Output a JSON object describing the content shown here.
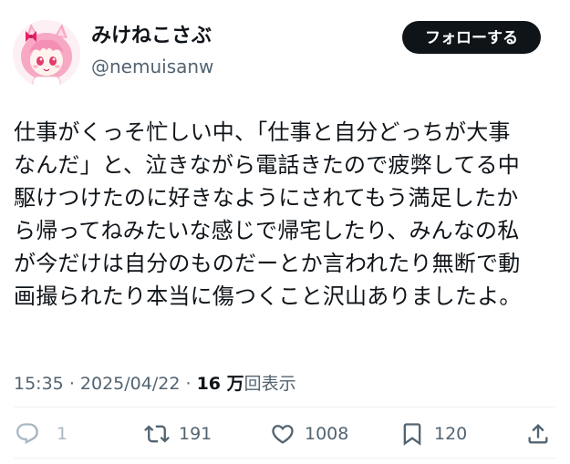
{
  "author": {
    "display_name": "みけねこさぶ",
    "handle": "@nemuisanw"
  },
  "follow_button_label": "フォローする",
  "tweet": {
    "lines": [
      "仕事がくっそ忙しい中、「仕事と自分どっちが大事",
      "なんだ」と、泣きながら電話きたので疲弊してる中",
      "駆けつけたのに好きなようにされてもう満足したか",
      "ら帰ってねみたいな感じで帰宅したり、みんなの私",
      "が今だけは自分のものだーとか言われたり無断で動",
      "画撮られたり本当に傷つくこと沢山ありましたよ。"
    ]
  },
  "meta": {
    "time": "15:35",
    "separator": "·",
    "date": "2025/04/22",
    "views_count": "16 万",
    "views_label": "回表示"
  },
  "actions": {
    "reply_count": "1",
    "retweet_count": "191",
    "like_count": "1008",
    "bookmark_count": "120"
  },
  "icons": {
    "reply": "reply-icon",
    "retweet": "retweet-icon",
    "like": "heart-icon",
    "bookmark": "bookmark-icon",
    "share": "share-icon"
  },
  "colors": {
    "text": "#0f1419",
    "secondary": "#536471",
    "button_bg": "#0f1419",
    "button_text": "#ffffff",
    "divider": "#eff3f4",
    "muted_icon": "#aab8c2"
  }
}
